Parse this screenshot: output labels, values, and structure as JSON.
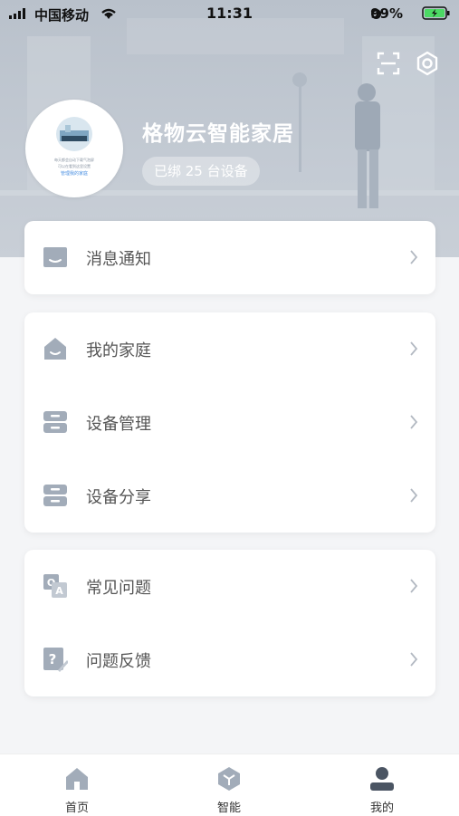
{
  "status_bar": {
    "carrier": "中国移动",
    "time": "11:31",
    "battery": "99%"
  },
  "header": {
    "home_name": "格物云智能家居",
    "device_badge": "已绑 25 台设备"
  },
  "avatar": {
    "caption_line1": "每天都会自动下载气泡屏",
    "caption_line2": "可以在看到这里设置",
    "caption_link": "管理我的家庭"
  },
  "menu": {
    "message": "消息通知",
    "my_home": "我的家庭",
    "device_manage": "设备管理",
    "device_share": "设备分享",
    "faq": "常见问题",
    "feedback": "问题反馈"
  },
  "tabs": {
    "home": "首页",
    "smart": "智能",
    "mine": "我的"
  },
  "colors": {
    "icon_gray": "#a2acb9",
    "active_tab": "#4b5563",
    "hero_bg": "#bfc7d0"
  }
}
